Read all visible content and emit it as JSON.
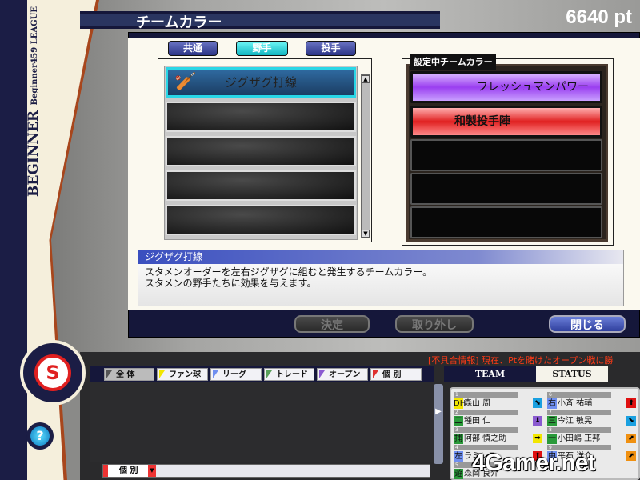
{
  "header": {
    "title": "チームカラー",
    "points": "6640 pt"
  },
  "sidebar": {
    "league": "Beginner459 LEAGUE",
    "rank": "BEGINNER",
    "help_icon": "?"
  },
  "tabs": [
    {
      "label": "共通",
      "active": false
    },
    {
      "label": "野手",
      "active": true
    },
    {
      "label": "投手",
      "active": false
    }
  ],
  "available_list": {
    "items": [
      "ジグザグ打線",
      "",
      "",
      "",
      ""
    ],
    "selected": "ジグザグ打線"
  },
  "current_colors": {
    "label": "設定中チームカラー",
    "items": [
      "フレッシュマンパワー",
      "和製投手陣",
      "",
      "",
      ""
    ],
    "colors": [
      "#9a3ef0",
      "#e02020"
    ]
  },
  "description": {
    "title": "ジグザグ打線",
    "lines": [
      "スタメンオーダーを左右ジグザグに組むと発生するチームカラー。",
      "スタメンの野手たちに効果を与えます。"
    ]
  },
  "buttons": {
    "decide": "決定",
    "remove": "取り外し",
    "close": "閉じる"
  },
  "ticker": "[不具合情報] 現在、Ptを賭けたオープン戦に勝",
  "filters": [
    {
      "label": "全 体",
      "color": "#555555"
    },
    {
      "label": "ファン球団",
      "color": "#f2e600"
    },
    {
      "label": "リーグ",
      "color": "#6f8ff0"
    },
    {
      "label": "トレード",
      "color": "#5aa05a"
    },
    {
      "label": "オープン戦",
      "color": "#8a5ad0"
    },
    {
      "label": "個 別",
      "color": "#e03030"
    }
  ],
  "log_filter": {
    "selected": "個 別"
  },
  "panel_tabs": {
    "team": "TEAM",
    "status": "STATUS"
  },
  "roster": [
    {
      "order": "1",
      "pos": "DH",
      "pos_color": "#f2e600",
      "name": "森山 周",
      "trend": "down-right",
      "trend_color": "#1aa0e0"
    },
    {
      "order": "2",
      "pos": "二",
      "pos_color": "#2a9a3a",
      "name": "種田 仁",
      "trend": "down",
      "trend_color": "#8a5ad0"
    },
    {
      "order": "3",
      "pos": "捕",
      "pos_color": "#2a9a3a",
      "name": "阿部 慎之助",
      "trend": "right",
      "trend_color": "#f2e600"
    },
    {
      "order": "4",
      "pos": "左",
      "pos_color": "#6f8ff0",
      "name": "ラミレス",
      "trend": "up",
      "trend_color": "#e01010"
    },
    {
      "order": "5",
      "pos": "遊",
      "pos_color": "#2a9a3a",
      "name": "森岡 良介",
      "trend": "",
      "trend_color": ""
    },
    {
      "order": "6",
      "pos": "右",
      "pos_color": "#6f8ff0",
      "name": "小斉 祐輔",
      "trend": "up",
      "trend_color": "#e01010"
    },
    {
      "order": "7",
      "pos": "三",
      "pos_color": "#2a9a3a",
      "name": "今江 敏晃",
      "trend": "down-right",
      "trend_color": "#1aa0e0"
    },
    {
      "order": "8",
      "pos": "一",
      "pos_color": "#2a9a3a",
      "name": "小田嶋 正邦",
      "trend": "up-right",
      "trend_color": "#f09010"
    },
    {
      "order": "9",
      "pos": "中",
      "pos_color": "#6f8ff0",
      "name": "平石 洋介",
      "trend": "up-right",
      "trend_color": "#f09010"
    }
  ],
  "watermark": "4Gamer.net"
}
